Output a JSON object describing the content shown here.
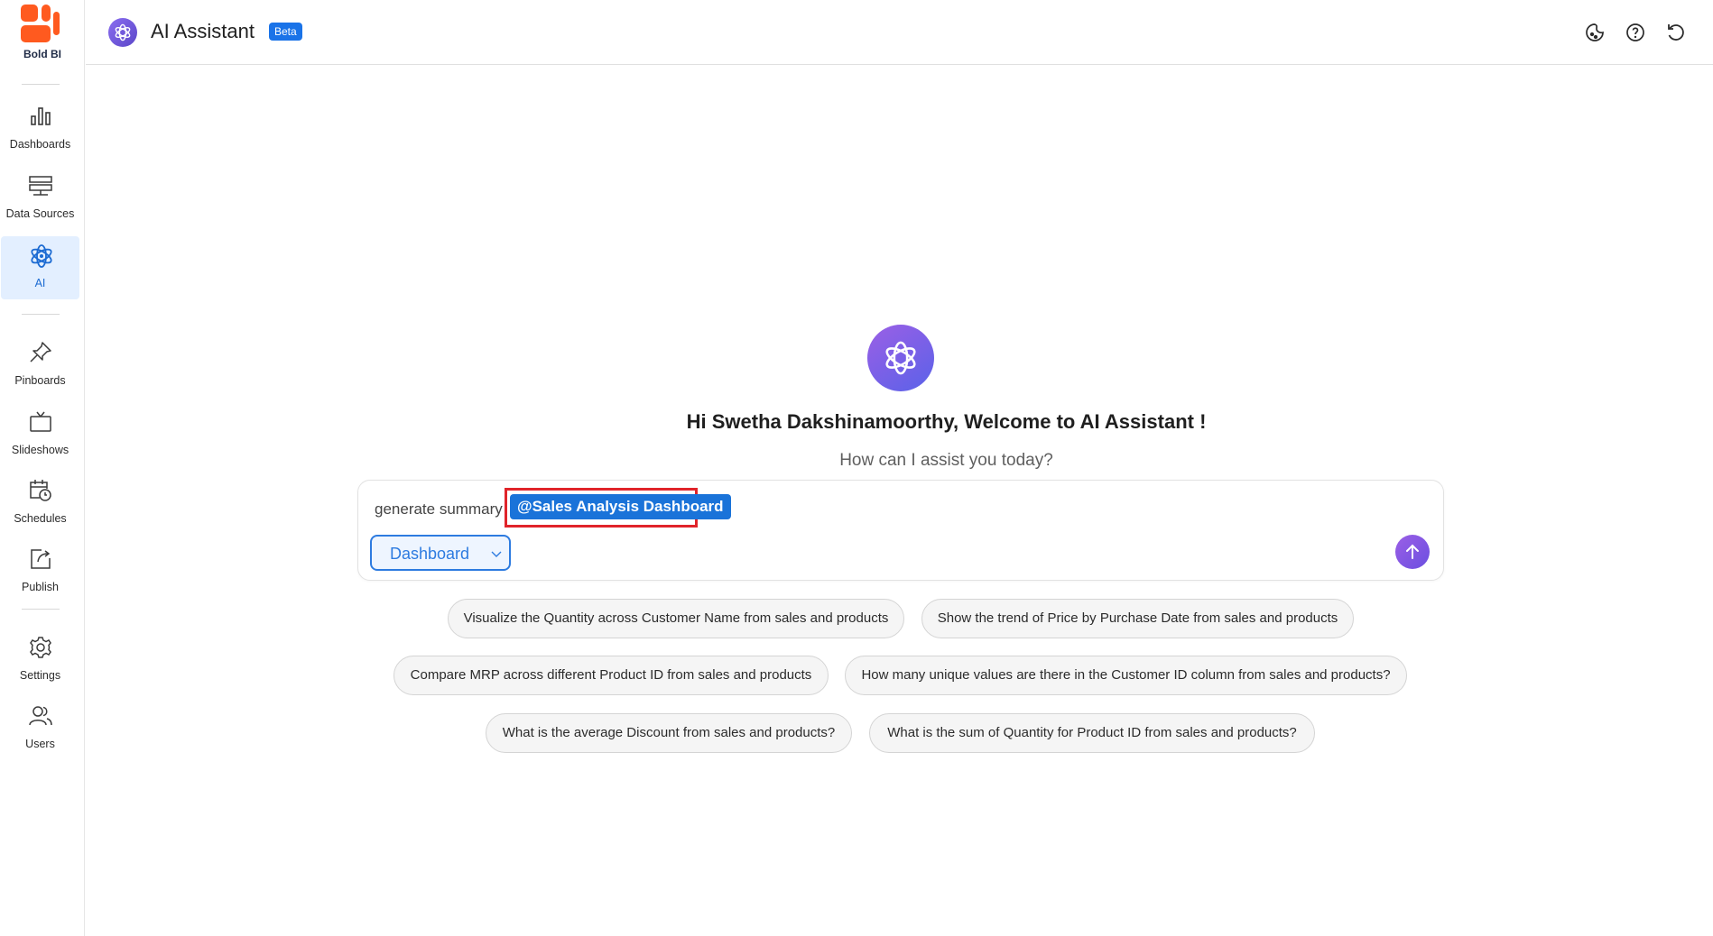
{
  "sidebar": {
    "brand": "Bold BI",
    "items": [
      {
        "label": "Dashboards",
        "icon": "bar-chart-icon"
      },
      {
        "label": "Data Sources",
        "icon": "database-icon"
      },
      {
        "label": "AI",
        "icon": "atom-icon",
        "active": true
      },
      {
        "label": "Pinboards",
        "icon": "pin-icon"
      },
      {
        "label": "Slideshows",
        "icon": "tv-icon"
      },
      {
        "label": "Schedules",
        "icon": "calendar-clock-icon"
      },
      {
        "label": "Publish",
        "icon": "publish-icon"
      },
      {
        "label": "Settings",
        "icon": "gear-icon"
      },
      {
        "label": "Users",
        "icon": "users-icon"
      }
    ]
  },
  "header": {
    "title": "AI Assistant",
    "badge": "Beta",
    "icons": [
      "theme-icon",
      "help-icon",
      "reset-icon"
    ]
  },
  "main": {
    "welcome": "Hi Swetha Dakshinamoorthy, Welcome to AI Assistant !",
    "subtitle": "How can I assist you today?",
    "prompt_text": "generate summary",
    "mention": "@Sales Analysis Dashboard",
    "selector": "Dashboard",
    "suggestions": [
      "Visualize the Quantity across Customer Name from sales and products",
      "Show the trend of Price by Purchase Date from sales and products",
      "Compare MRP across different Product ID from sales and products",
      "How many unique values are there in the Customer ID column from sales and products?",
      "What is the average Discount from sales and products?",
      "What is the sum of Quantity for Product ID from sales and products?"
    ]
  },
  "colors": {
    "accent": "#1a73e8",
    "brand_orange": "#ff5a1f",
    "highlight_border": "#e0242a",
    "ai_gradient_start": "#9b5fe6",
    "ai_gradient_end": "#5a62e8"
  }
}
